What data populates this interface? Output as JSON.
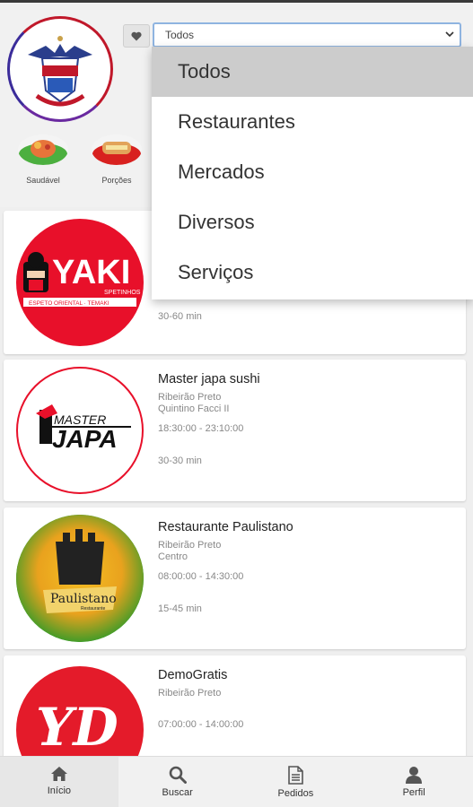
{
  "filter": {
    "selected": "Todos",
    "options": [
      "Todos",
      "Restaurantes",
      "Mercados",
      "Diversos",
      "Serviços"
    ]
  },
  "categories": [
    {
      "label": "Saudável"
    },
    {
      "label": "Porções"
    }
  ],
  "restaurants": [
    {
      "name": "",
      "city": "",
      "district": "",
      "hours": "",
      "eta": "30-60 min",
      "logo_text": "YAKI",
      "logo_sub": "SPETINHOS",
      "logo_sub2": "ESPETO ORIENTAL · TEMAKI"
    },
    {
      "name": "Master japa sushi",
      "city": "Ribeirão Preto",
      "district": "Quintino Facci II",
      "hours": "18:30:00 - 23:10:00",
      "eta": "30-30 min",
      "logo_text": "MASTER",
      "logo_text2": "JAPA"
    },
    {
      "name": "Restaurante Paulistano",
      "city": "Ribeirão Preto",
      "district": "Centro",
      "hours": "08:00:00 - 14:30:00",
      "eta": "15-45 min",
      "logo_text": "Paulistano",
      "logo_sub": "Restaurante"
    },
    {
      "name": "DemoGratis",
      "city": "Ribeirão Preto",
      "district": "",
      "hours": "07:00:00 - 14:00:00",
      "eta": "",
      "logo_text": "YD"
    }
  ],
  "tabbar": [
    {
      "label": "Início",
      "icon": "home-icon"
    },
    {
      "label": "Buscar",
      "icon": "search-icon"
    },
    {
      "label": "Pedidos",
      "icon": "document-icon"
    },
    {
      "label": "Perfil",
      "icon": "user-icon"
    }
  ],
  "colors": {
    "accent": "#8fb4e0",
    "yaki_red": "#e8102a",
    "paulistano_green": "#1f9a2a",
    "yd_red": "#e41b2a"
  }
}
